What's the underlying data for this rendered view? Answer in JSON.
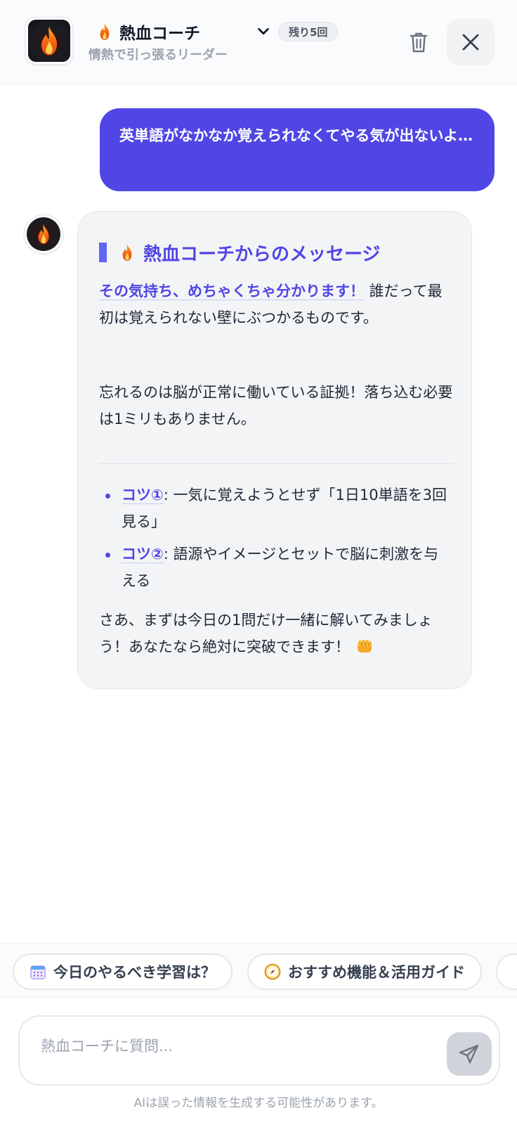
{
  "header": {
    "title": "熱血コーチ",
    "subtitle": "情熱で引っ張るリーダー",
    "badge": "残り5回",
    "avatar_icon": "flame-icon",
    "title_icon": "flame-icon"
  },
  "conversation": {
    "user_message": "英単語がなかなか覚えられなくてやる気が出ないよ…",
    "bot_message": {
      "heading": "熱血コーチからのメッセージ",
      "para1_strong": "その気持ち、めちゃくちゃ分かります！",
      "para1_rest": " 誰だって最初は覚えられない壁にぶつかるものです。",
      "para2": "忘れるのは脳が正常に働いている証拠！落ち込む必要は1ミリもありません。",
      "tips": [
        {
          "key": "コツ①",
          "text": ": 一気に覚えようとせず「1日10単語を3回見る」"
        },
        {
          "key": "コツ②",
          "text": ": 語源やイメージとセットで脳に刺激を与える"
        }
      ],
      "closing": "さあ、まずは今日の1問だけ一緒に解いてみましょう！あなたなら絶対に突破できます！",
      "closing_icon": "fist-icon"
    }
  },
  "suggestions": [
    {
      "label": "今日のやるべき学習は？",
      "icon": "calendar-icon"
    },
    {
      "label": "おすすめ機能＆活用ガイド",
      "icon": "compass-icon"
    }
  ],
  "input": {
    "placeholder": "熱血コーチに質問...",
    "value": ""
  },
  "disclaimer": "AIは誤った情報を生成する可能性があります。",
  "colors": {
    "accent": "#4f46e5",
    "user_bubble": "#4f46e5",
    "bot_bubble": "#f3f4f6"
  }
}
